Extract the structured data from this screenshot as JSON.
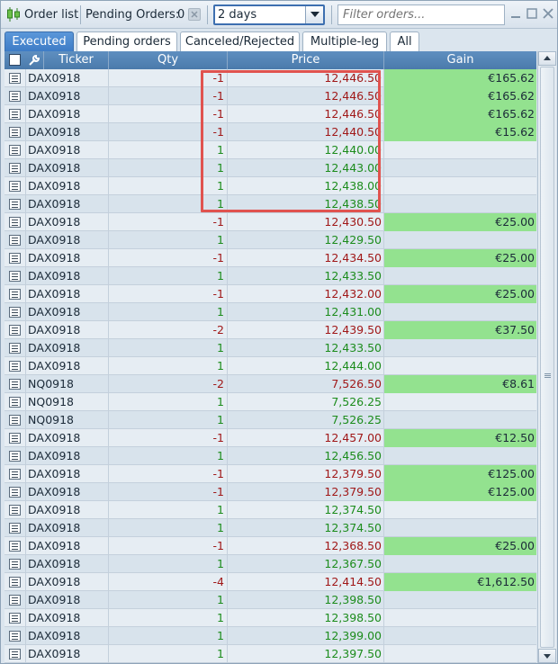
{
  "toolbar": {
    "title": "Order list",
    "pending_label": "Pending Orders:",
    "pending_count": "0",
    "period_value": "2 days",
    "filter_placeholder": "Filter orders..."
  },
  "tabs": [
    {
      "label": "Executed",
      "active": true
    },
    {
      "label": "Pending orders",
      "active": false
    },
    {
      "label": "Canceled/Rejected",
      "active": false
    },
    {
      "label": "Multiple-leg",
      "active": false
    },
    {
      "label": "All",
      "active": false
    }
  ],
  "table": {
    "columns": {
      "ticker": "Ticker",
      "qty": "Qty",
      "price": "Price",
      "gain": "Gain"
    },
    "rows": [
      {
        "ticker": "DAX0918",
        "qty": "-1",
        "price": "12,446.50",
        "gain": "€165.62"
      },
      {
        "ticker": "DAX0918",
        "qty": "-1",
        "price": "12,446.50",
        "gain": "€165.62"
      },
      {
        "ticker": "DAX0918",
        "qty": "-1",
        "price": "12,446.50",
        "gain": "€165.62"
      },
      {
        "ticker": "DAX0918",
        "qty": "-1",
        "price": "12,440.50",
        "gain": "€15.62"
      },
      {
        "ticker": "DAX0918",
        "qty": "1",
        "price": "12,440.00",
        "gain": ""
      },
      {
        "ticker": "DAX0918",
        "qty": "1",
        "price": "12,443.00",
        "gain": ""
      },
      {
        "ticker": "DAX0918",
        "qty": "1",
        "price": "12,438.00",
        "gain": ""
      },
      {
        "ticker": "DAX0918",
        "qty": "1",
        "price": "12,438.50",
        "gain": ""
      },
      {
        "ticker": "DAX0918",
        "qty": "-1",
        "price": "12,430.50",
        "gain": "€25.00"
      },
      {
        "ticker": "DAX0918",
        "qty": "1",
        "price": "12,429.50",
        "gain": ""
      },
      {
        "ticker": "DAX0918",
        "qty": "-1",
        "price": "12,434.50",
        "gain": "€25.00"
      },
      {
        "ticker": "DAX0918",
        "qty": "1",
        "price": "12,433.50",
        "gain": ""
      },
      {
        "ticker": "DAX0918",
        "qty": "-1",
        "price": "12,432.00",
        "gain": "€25.00"
      },
      {
        "ticker": "DAX0918",
        "qty": "1",
        "price": "12,431.00",
        "gain": ""
      },
      {
        "ticker": "DAX0918",
        "qty": "-2",
        "price": "12,439.50",
        "gain": "€37.50"
      },
      {
        "ticker": "DAX0918",
        "qty": "1",
        "price": "12,433.50",
        "gain": ""
      },
      {
        "ticker": "DAX0918",
        "qty": "1",
        "price": "12,444.00",
        "gain": ""
      },
      {
        "ticker": "NQ0918",
        "qty": "-2",
        "price": "7,526.50",
        "gain": "€8.61"
      },
      {
        "ticker": "NQ0918",
        "qty": "1",
        "price": "7,526.25",
        "gain": ""
      },
      {
        "ticker": "NQ0918",
        "qty": "1",
        "price": "7,526.25",
        "gain": ""
      },
      {
        "ticker": "DAX0918",
        "qty": "-1",
        "price": "12,457.00",
        "gain": "€12.50"
      },
      {
        "ticker": "DAX0918",
        "qty": "1",
        "price": "12,456.50",
        "gain": ""
      },
      {
        "ticker": "DAX0918",
        "qty": "-1",
        "price": "12,379.50",
        "gain": "€125.00"
      },
      {
        "ticker": "DAX0918",
        "qty": "-1",
        "price": "12,379.50",
        "gain": "€125.00"
      },
      {
        "ticker": "DAX0918",
        "qty": "1",
        "price": "12,374.50",
        "gain": ""
      },
      {
        "ticker": "DAX0918",
        "qty": "1",
        "price": "12,374.50",
        "gain": ""
      },
      {
        "ticker": "DAX0918",
        "qty": "-1",
        "price": "12,368.50",
        "gain": "€25.00"
      },
      {
        "ticker": "DAX0918",
        "qty": "1",
        "price": "12,367.50",
        "gain": ""
      },
      {
        "ticker": "DAX0918",
        "qty": "-4",
        "price": "12,414.50",
        "gain": "€1,612.50"
      },
      {
        "ticker": "DAX0918",
        "qty": "1",
        "price": "12,398.50",
        "gain": ""
      },
      {
        "ticker": "DAX0918",
        "qty": "1",
        "price": "12,398.50",
        "gain": ""
      },
      {
        "ticker": "DAX0918",
        "qty": "1",
        "price": "12,399.00",
        "gain": ""
      },
      {
        "ticker": "DAX0918",
        "qty": "1",
        "price": "12,397.50",
        "gain": ""
      }
    ]
  },
  "colors": {
    "tab_active": "#3e7cc6",
    "header_bg": "#4b7aab",
    "gain_bg": "#93e28f",
    "negative": "#a01818",
    "positive": "#1c8c1c",
    "highlight_border": "#e0534f"
  }
}
